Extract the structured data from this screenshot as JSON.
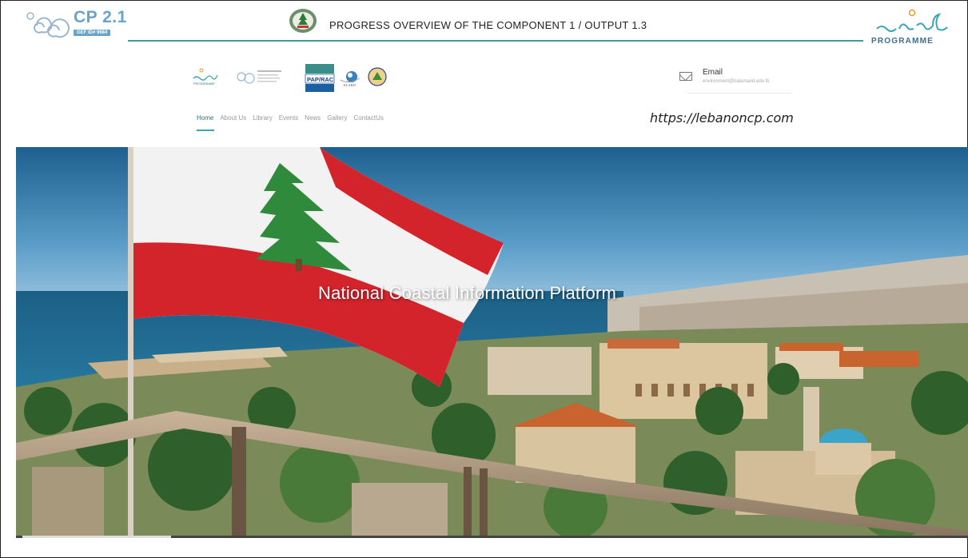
{
  "slide": {
    "title": "PROGRESS OVERVIEW  OF THE COMPONENT 1 / OUTPUT 1.3",
    "cp_logo_text": "CP 2.1",
    "cp_logo_tag": "GEF ID# 9684",
    "med_logo_text": "PROGRAMME",
    "url": "https://lebanoncp.com"
  },
  "site": {
    "logos": [
      "med-programme-logo",
      "cp21-logo",
      "pap-rac-logo",
      "elard-logo",
      "round-emblem-logo"
    ],
    "logo_labels": {
      "pap_rac": "PAP/RAC",
      "elard": "ELARD"
    },
    "contact": {
      "email_label": "Email",
      "email_address": "environment@balamand.edu.lb"
    },
    "nav": [
      {
        "label": "Home",
        "active": true
      },
      {
        "label": "About Us",
        "active": false
      },
      {
        "label": "Library",
        "active": false
      },
      {
        "label": "Events",
        "active": false
      },
      {
        "label": "News",
        "active": false
      },
      {
        "label": "Gallery",
        "active": false
      },
      {
        "label": "ContactUs",
        "active": false
      }
    ],
    "hero": {
      "title": "National Coastal Information Platform",
      "image_icon": "lebanon-flag-coast-photo"
    }
  },
  "colors": {
    "accent_line": "#3d9ba0",
    "nav_active": "#2a6f84",
    "flag_red": "#d3232b",
    "flag_green": "#2f8a3c"
  }
}
